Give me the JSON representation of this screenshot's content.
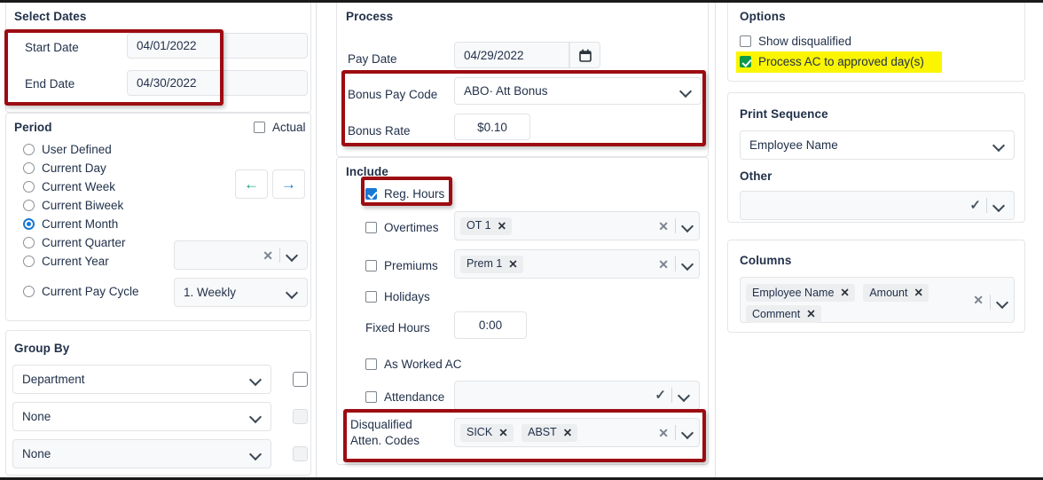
{
  "left_panel": {
    "select_dates": {
      "title": "Select Dates",
      "start_label": "Start Date",
      "start_value": "04/01/2022",
      "end_label": "End Date",
      "end_value": "04/30/2022"
    },
    "period": {
      "title": "Period",
      "actual_label": "Actual",
      "actual_checked": false,
      "options": [
        {
          "label": "User Defined",
          "selected": false
        },
        {
          "label": "Current Day",
          "selected": false
        },
        {
          "label": "Current Week",
          "selected": false
        },
        {
          "label": "Current Biweek",
          "selected": false
        },
        {
          "label": "Current Month",
          "selected": true
        },
        {
          "label": "Current Quarter",
          "selected": false
        },
        {
          "label": "Current Year",
          "selected": false
        },
        {
          "label": "Current Pay Cycle",
          "selected": false
        }
      ],
      "prev_arrow": "←",
      "next_arrow": "→",
      "quarter_year_select_value": "",
      "pay_cycle_value": "1. Weekly"
    },
    "group_by": {
      "title": "Group By",
      "rows": [
        {
          "value": "Department",
          "checkbox_enabled": true
        },
        {
          "value": "None",
          "checkbox_enabled": false
        },
        {
          "value": "None",
          "checkbox_enabled": false
        }
      ]
    }
  },
  "mid_panel": {
    "process": {
      "title": "Process",
      "pay_date_label": "Pay Date",
      "pay_date_value": "04/29/2022",
      "bonus_pay_code_label": "Bonus Pay Code",
      "bonus_pay_code_value": "ABO· Att Bonus",
      "bonus_rate_label": "Bonus Rate",
      "bonus_rate_value": "$0.10"
    },
    "include": {
      "title": "Include",
      "reg_hours_label": "Reg. Hours",
      "reg_hours_checked": true,
      "overtimes_label": "Overtimes",
      "overtimes_checked": false,
      "overtimes_chips": [
        "OT 1"
      ],
      "premiums_label": "Premiums",
      "premiums_checked": false,
      "premiums_chips": [
        "Prem 1"
      ],
      "holidays_label": "Holidays",
      "holidays_checked": false,
      "fixed_hours_label": "Fixed Hours",
      "fixed_hours_value": "0:00",
      "as_worked_ac_label": "As Worked AC",
      "as_worked_ac_checked": false,
      "attendance_label": "Attendance",
      "attendance_checked": false,
      "attendance_value": "",
      "disqualified_label_line1": "Disqualified",
      "disqualified_label_line2": "Atten. Codes",
      "disqualified_chips": [
        "SICK",
        "ABST"
      ]
    }
  },
  "right_panel": {
    "options": {
      "title": "Options",
      "show_disqualified_label": "Show disqualified",
      "show_disqualified_checked": false,
      "process_ac_label": "Process AC to approved day(s)",
      "process_ac_checked": true
    },
    "print_sequence": {
      "title": "Print Sequence",
      "value": "Employee Name",
      "other_label": "Other",
      "other_value": ""
    },
    "columns": {
      "title": "Columns",
      "chips": [
        "Employee Name",
        "Amount",
        "Comment"
      ]
    }
  },
  "colors": {
    "annotation_red": "#9c0c12",
    "highlight_yellow": "#fcf500",
    "checkbox_blue": "#1878d4",
    "checkbox_green": "#0a9a48",
    "arrow_prev_teal": "#12a07c",
    "arrow_next_blue": "#1878d4"
  }
}
